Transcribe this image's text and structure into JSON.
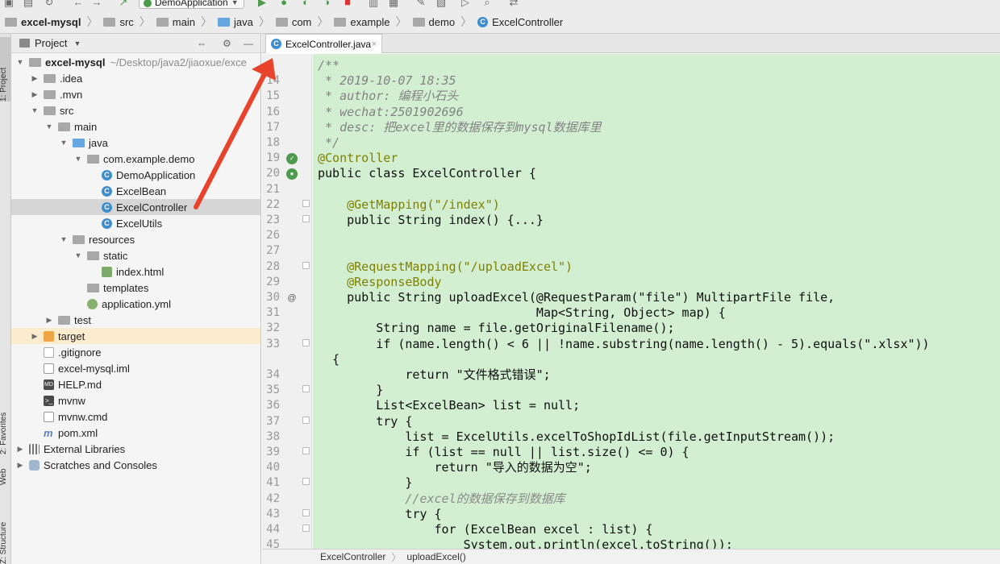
{
  "toolbar": {
    "run_config": "DemoApplication",
    "icons": [
      "save-icon",
      "sync-icon",
      "refresh-icon",
      "back-icon",
      "forward-icon",
      "build-icon",
      "run-config-icon",
      "run-icon",
      "debug-icon",
      "coverage-icon",
      "profile-icon",
      "stop-icon",
      "settings-icon",
      "sdk-icon",
      "vcs-icon",
      "vcs2-icon",
      "terminal-icon",
      "search-icon",
      "git-icon"
    ]
  },
  "breadcrumb": {
    "items": [
      "excel-mysql",
      "src",
      "main",
      "java",
      "com",
      "example",
      "demo",
      "ExcelController"
    ]
  },
  "left_strip": {
    "project": "1: Project",
    "favorites": "2: Favorites",
    "web": "Web",
    "structure": "Z: Structure"
  },
  "project_panel": {
    "title": "Project",
    "root_name": "excel-mysql",
    "root_path": "~/Desktop/java2/jiaoxue/exce",
    "tree": [
      {
        "label": ".idea",
        "icon": "folder"
      },
      {
        "label": ".mvn",
        "icon": "folder"
      },
      {
        "label": "src",
        "icon": "folder"
      },
      {
        "label": "main",
        "icon": "folder"
      },
      {
        "label": "java",
        "icon": "source-folder"
      },
      {
        "label": "com.example.demo",
        "icon": "package"
      },
      {
        "label": "DemoApplication",
        "icon": "class"
      },
      {
        "label": "ExcelBean",
        "icon": "class"
      },
      {
        "label": "ExcelController",
        "icon": "class"
      },
      {
        "label": "ExcelUtils",
        "icon": "class"
      },
      {
        "label": "resources",
        "icon": "resources-folder"
      },
      {
        "label": "static",
        "icon": "folder"
      },
      {
        "label": "index.html",
        "icon": "html"
      },
      {
        "label": "templates",
        "icon": "folder"
      },
      {
        "label": "application.yml",
        "icon": "yml"
      },
      {
        "label": "test",
        "icon": "folder"
      },
      {
        "label": "target",
        "icon": "excluded-folder"
      },
      {
        "label": ".gitignore",
        "icon": "file"
      },
      {
        "label": "excel-mysql.iml",
        "icon": "iml"
      },
      {
        "label": "HELP.md",
        "icon": "md"
      },
      {
        "label": "mvnw",
        "icon": "shell"
      },
      {
        "label": "mvnw.cmd",
        "icon": "file"
      },
      {
        "label": "pom.xml",
        "icon": "maven"
      },
      {
        "label": "External Libraries",
        "icon": "libraries"
      },
      {
        "label": "Scratches and Consoles",
        "icon": "scratches"
      }
    ],
    "selected": "ExcelController"
  },
  "editor": {
    "tab": "ExcelController.java",
    "lines": [
      {
        "n": "",
        "text": "/**"
      },
      {
        "n": "14",
        "text": " * 2019-10-07 18:35"
      },
      {
        "n": "15",
        "text": " * author: 编程小石头"
      },
      {
        "n": "16",
        "text": " * wechat:2501902696"
      },
      {
        "n": "17",
        "text": " * desc: 把excel里的数据保存到mysql数据库里"
      },
      {
        "n": "18",
        "text": " */"
      },
      {
        "n": "19",
        "text": "@Controller"
      },
      {
        "n": "20",
        "text": "public class ExcelController {"
      },
      {
        "n": "21",
        "text": ""
      },
      {
        "n": "22",
        "text": "    @GetMapping(\"/index\")"
      },
      {
        "n": "23",
        "text": "    public String index() {...}"
      },
      {
        "n": "26",
        "text": ""
      },
      {
        "n": "27",
        "text": ""
      },
      {
        "n": "28",
        "text": "    @RequestMapping(\"/uploadExcel\")"
      },
      {
        "n": "29",
        "text": "    @ResponseBody"
      },
      {
        "n": "30",
        "text": "    public String uploadExcel(@RequestParam(\"file\") MultipartFile file,"
      },
      {
        "n": "31",
        "text": "                              Map<String, Object> map) {"
      },
      {
        "n": "32",
        "text": "        String name = file.getOriginalFilename();"
      },
      {
        "n": "33",
        "text": "        if (name.length() < 6 || !name.substring(name.length() - 5).equals(\".xlsx\"))"
      },
      {
        "n": "",
        "text": "  {"
      },
      {
        "n": "34",
        "text": "            return \"文件格式错误\";"
      },
      {
        "n": "35",
        "text": "        }"
      },
      {
        "n": "36",
        "text": "        List<ExcelBean> list = null;"
      },
      {
        "n": "37",
        "text": "        try {"
      },
      {
        "n": "38",
        "text": "            list = ExcelUtils.excelToShopIdList(file.getInputStream());"
      },
      {
        "n": "39",
        "text": "            if (list == null || list.size() <= 0) {"
      },
      {
        "n": "40",
        "text": "                return \"导入的数据为空\";"
      },
      {
        "n": "41",
        "text": "            }"
      },
      {
        "n": "42",
        "text": "            //excel的数据保存到数据库"
      },
      {
        "n": "43",
        "text": "            try {"
      },
      {
        "n": "44",
        "text": "                for (ExcelBean excel : list) {"
      },
      {
        "n": "45",
        "text": "                    System.out.println(excel.toString());"
      }
    ]
  },
  "status_crumbs": [
    "ExcelController",
    "uploadExcel()"
  ],
  "colors": {
    "code_bg": "#d3efd1",
    "annotation": "#808000",
    "keyword": "#000080",
    "string": "#0b7b12",
    "arrow": "#e8442c"
  }
}
